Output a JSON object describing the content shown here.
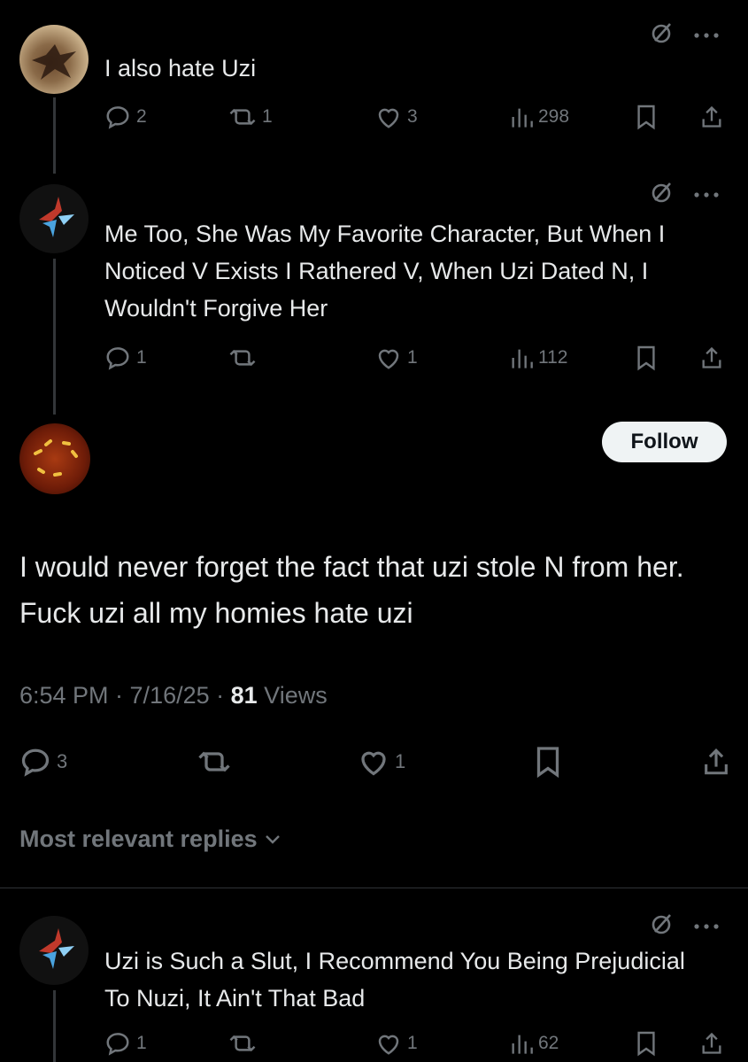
{
  "replies_above": [
    {
      "text": "I also hate Uzi",
      "stats": {
        "replies": "2",
        "reposts": "1",
        "likes": "3",
        "views": "298"
      }
    },
    {
      "text": "Me Too, She Was My Favorite Character, But When I Noticed V Exists I Rathered V, When Uzi Dated N, I Wouldn't Forgive Her",
      "stats": {
        "replies": "1",
        "reposts": "",
        "likes": "1",
        "views": "112"
      }
    }
  ],
  "main_post": {
    "follow_label": "Follow",
    "text": "I would never forget the fact that uzi stole N from her. Fuck uzi all my homies hate uzi",
    "timestamp": "6:54 PM · 7/16/25 · ",
    "views_count": "81",
    "views_label": " Views",
    "stats": {
      "replies": "3",
      "reposts": "",
      "likes": "1"
    }
  },
  "sort_label": "Most relevant replies",
  "replies_below": [
    {
      "text": "Uzi is Such a Slut, I Recommend You Being Prejudicial To Nuzi, It Ain't That Bad",
      "stats": {
        "replies": "1",
        "reposts": "",
        "likes": "1",
        "views": "62"
      }
    }
  ],
  "colors": {
    "background": "#000000",
    "text": "#e7e9ea",
    "muted": "#71767b",
    "follow_bg": "#eff3f4"
  },
  "icons": [
    "reply-icon",
    "repost-icon",
    "like-icon",
    "views-icon",
    "bookmark-icon",
    "share-icon",
    "grok-icon",
    "more-icon",
    "chevron-down-icon"
  ]
}
